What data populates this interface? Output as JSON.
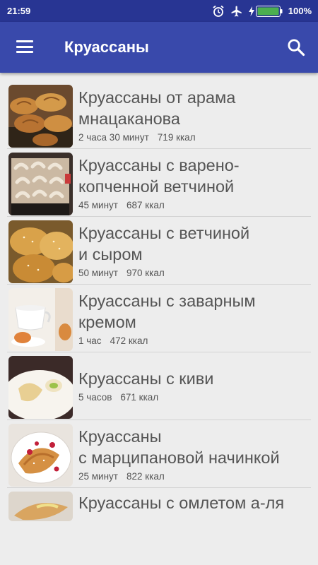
{
  "status_bar": {
    "time": "21:59",
    "icons": [
      "alarm-icon",
      "airplane-mode-icon",
      "charging-icon",
      "battery-icon"
    ],
    "battery_percent": "100%",
    "battery_level": 1.0
  },
  "app_bar": {
    "title": "Круассаны",
    "menu_icon": "hamburger-menu-icon",
    "search_icon": "search-icon"
  },
  "colors": {
    "status_bar": "#283593",
    "app_bar": "#3949ab",
    "background": "#ededed",
    "battery_fill": "#4caf50"
  },
  "recipes": [
    {
      "title_line1": "Круассаны от арама",
      "title_line2": "мнацаканова",
      "time": "2 часа 30 минут",
      "kcal": "719 ккал"
    },
    {
      "title_line1": "Круассаны с варено-",
      "title_line2": "копченной ветчиной",
      "time": "45 минут",
      "kcal": "687 ккал"
    },
    {
      "title_line1": "Круассаны с ветчиной",
      "title_line2": "и сыром",
      "time": "50 минут",
      "kcal": "970 ккал"
    },
    {
      "title_line1": "Круассаны с заварным",
      "title_line2": "кремом",
      "time": "1 час",
      "kcal": "472 ккал"
    },
    {
      "title_line1": "Круассаны с киви",
      "time": "5 часов",
      "kcal": "671 ккал"
    },
    {
      "title_line1": "Круассаны",
      "title_line2": "с марципановой начинкой",
      "time": "25 минут",
      "kcal": "822 ккал"
    },
    {
      "title_line1": "Круассаны с омлетом а-ля"
    }
  ]
}
